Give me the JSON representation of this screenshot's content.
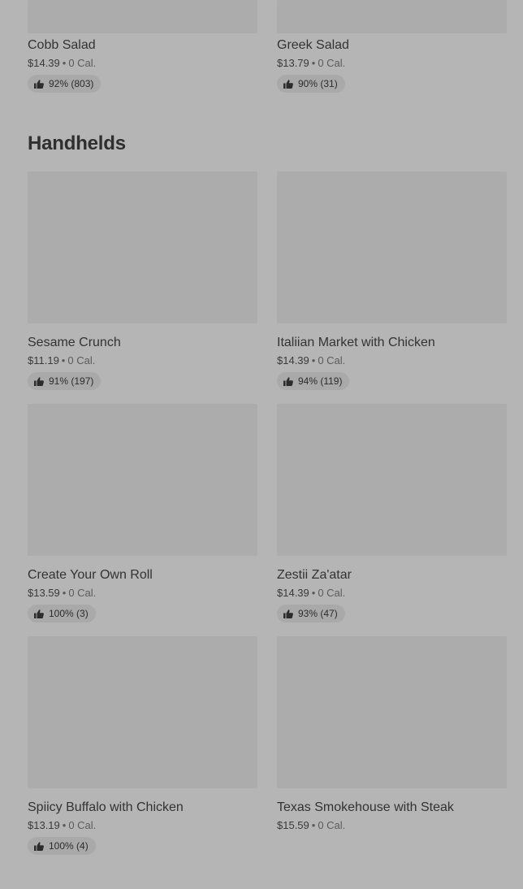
{
  "top_items": [
    {
      "name": "Cobb Salad",
      "price": "$14.39",
      "sep": "•",
      "calories": "0 Cal.",
      "rating": "92% (803)"
    },
    {
      "name": "Greek Salad",
      "price": "$13.79",
      "sep": "•",
      "calories": "0 Cal.",
      "rating": "90% (31)"
    }
  ],
  "section": {
    "title": "Handhelds",
    "items": [
      {
        "name": "Sesame Crunch",
        "price": "$11.19",
        "sep": "•",
        "calories": "0 Cal.",
        "rating": "91% (197)"
      },
      {
        "name": "Italiian Market with Chicken",
        "price": "$14.39",
        "sep": "•",
        "calories": "0 Cal.",
        "rating": "94% (119)"
      },
      {
        "name": "Create Your Own Roll",
        "price": "$13.59",
        "sep": "•",
        "calories": "0 Cal.",
        "rating": "100% (3)"
      },
      {
        "name": "Zestii Za'atar",
        "price": "$14.39",
        "sep": "•",
        "calories": "0 Cal.",
        "rating": "93% (47)"
      },
      {
        "name": "Spiicy Buffalo with Chicken",
        "price": "$13.19",
        "sep": "•",
        "calories": "0 Cal.",
        "rating": "100% (4)"
      },
      {
        "name": "Texas Smokehouse with Steak",
        "price": "$15.59",
        "sep": "•",
        "calories": "0 Cal."
      }
    ]
  },
  "icons": {
    "rating": "thumbs-up-icon"
  },
  "colors": {
    "background": "#b5b5b5",
    "image_placeholder": "#acacac",
    "rating_pill": "#a9a9a9"
  }
}
